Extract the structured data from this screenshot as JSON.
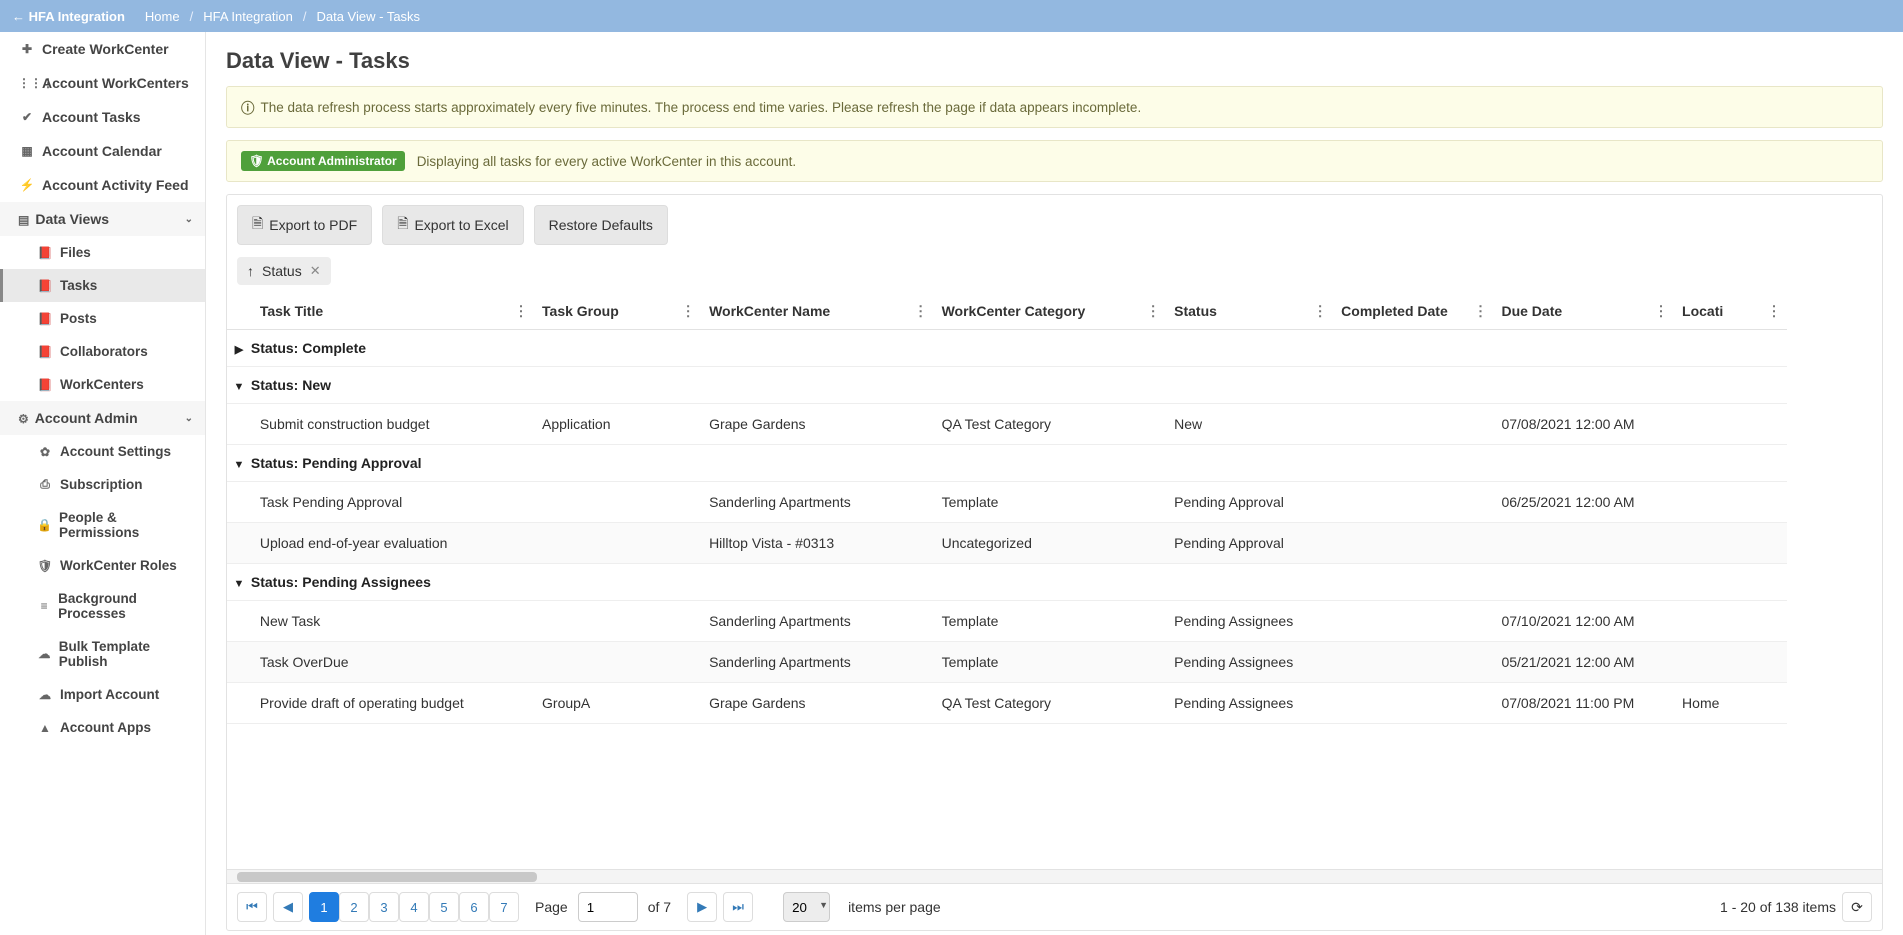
{
  "header": {
    "back_label": "HFA Integration",
    "breadcrumb": [
      "Home",
      "HFA Integration",
      "Data View - Tasks"
    ]
  },
  "sidebar": {
    "items": [
      {
        "icon": "✚",
        "label": "Create WorkCenter",
        "bold": true
      },
      {
        "icon": "⋮⋮⋮",
        "label": "Account WorkCenters",
        "bold": true
      },
      {
        "icon": "✔",
        "label": "Account Tasks",
        "bold": true
      },
      {
        "icon": "▦",
        "label": "Account Calendar",
        "bold": true
      },
      {
        "icon": "⚡",
        "label": "Account Activity Feed",
        "bold": true
      }
    ],
    "data_views": {
      "icon": "📕",
      "label": "Data Views",
      "expanded": true,
      "children": [
        {
          "icon": "📕",
          "label": "Files"
        },
        {
          "icon": "📕",
          "label": "Tasks",
          "active": true
        },
        {
          "icon": "📕",
          "label": "Posts"
        },
        {
          "icon": "📕",
          "label": "Collaborators"
        },
        {
          "icon": "📕",
          "label": "WorkCenters"
        }
      ]
    },
    "admin": {
      "icon": "⚙",
      "label": "Account Admin",
      "expanded": true,
      "children": [
        {
          "icon": "✿",
          "label": "Account Settings"
        },
        {
          "icon": "⎙",
          "label": "Subscription"
        },
        {
          "icon": "🔒",
          "label": "People & Permissions"
        },
        {
          "icon": "🛡",
          "label": "WorkCenter Roles"
        },
        {
          "icon": "≡",
          "label": "Background Processes"
        },
        {
          "icon": "☁",
          "label": "Bulk Template Publish"
        },
        {
          "icon": "☁",
          "label": "Import Account"
        },
        {
          "icon": "▲",
          "label": "Account Apps"
        }
      ]
    }
  },
  "page": {
    "title": "Data View - Tasks",
    "info_msg": "The data refresh process starts approximately every five minutes. The process end time varies. Please refresh the page if data appears incomplete.",
    "admin_badge": "Account Administrator",
    "admin_msg": "Displaying all tasks for every active WorkCenter in this account.",
    "buttons": {
      "pdf": "Export to PDF",
      "excel": "Export to Excel",
      "restore": "Restore Defaults"
    },
    "group_chip": {
      "dir": "↑",
      "label": "Status",
      "close": "✕"
    }
  },
  "grid": {
    "columns": [
      "Task Title",
      "Task Group",
      "WorkCenter Name",
      "WorkCenter Category",
      "Status",
      "Completed Date",
      "Due Date",
      "Locati"
    ],
    "groups": [
      {
        "label": "Status: Complete",
        "expanded": false,
        "rows": []
      },
      {
        "label": "Status: New",
        "expanded": true,
        "rows": [
          {
            "title": "Submit construction budget",
            "group": "Application",
            "wc": "Grape Gardens",
            "cat": "QA Test Category",
            "status": "New",
            "completed": "",
            "due": "07/08/2021 12:00 AM",
            "loc": ""
          }
        ]
      },
      {
        "label": "Status: Pending Approval",
        "expanded": true,
        "rows": [
          {
            "title": "Task Pending Approval",
            "group": "",
            "wc": "Sanderling Apartments",
            "cat": "Template",
            "status": "Pending Approval",
            "completed": "",
            "due": "06/25/2021 12:00 AM",
            "loc": ""
          },
          {
            "title": "Upload end-of-year evaluation",
            "group": "",
            "wc": "Hilltop Vista - #0313",
            "cat": "Uncategorized",
            "status": "Pending Approval",
            "completed": "",
            "due": "",
            "loc": ""
          }
        ]
      },
      {
        "label": "Status: Pending Assignees",
        "expanded": true,
        "rows": [
          {
            "title": "New Task",
            "group": "",
            "wc": "Sanderling Apartments",
            "cat": "Template",
            "status": "Pending Assignees",
            "completed": "",
            "due": "07/10/2021 12:00 AM",
            "loc": ""
          },
          {
            "title": "Task OverDue",
            "group": "",
            "wc": "Sanderling Apartments",
            "cat": "Template",
            "status": "Pending Assignees",
            "completed": "",
            "due": "05/21/2021 12:00 AM",
            "loc": ""
          },
          {
            "title": "Provide draft of operating budget",
            "group": "GroupA",
            "wc": "Grape Gardens",
            "cat": "QA Test Category",
            "status": "Pending Assignees",
            "completed": "",
            "due": "07/08/2021 11:00 PM",
            "loc": "Home"
          }
        ]
      }
    ]
  },
  "pager": {
    "pages": [
      1,
      2,
      3,
      4,
      5,
      6,
      7
    ],
    "current": 1,
    "page_label": "Page",
    "of_label": "of 7",
    "page_size": "20",
    "per_page_label": "items per page",
    "summary": "1 - 20 of 138 items"
  }
}
